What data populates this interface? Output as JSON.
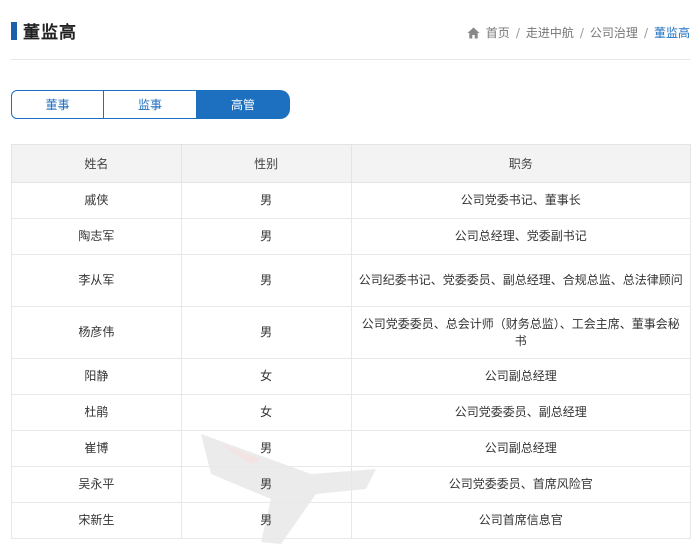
{
  "header": {
    "title": "董监高",
    "breadcrumb": [
      "首页",
      "走进中航",
      "公司治理",
      "董监高"
    ]
  },
  "tabs": [
    {
      "label": "董事",
      "active": false
    },
    {
      "label": "监事",
      "active": false
    },
    {
      "label": "高管",
      "active": true
    }
  ],
  "table": {
    "headers": [
      "姓名",
      "性别",
      "职务"
    ],
    "rows": [
      {
        "name": "戚侠",
        "gender": "男",
        "position": "公司党委书记、董事长"
      },
      {
        "name": "陶志军",
        "gender": "男",
        "position": "公司总经理、党委副书记"
      },
      {
        "name": "李从军",
        "gender": "男",
        "position": "公司纪委书记、党委委员、副总经理、合规总监、总法律顾问"
      },
      {
        "name": "杨彦伟",
        "gender": "男",
        "position": "公司党委委员、总会计师（财务总监）、工会主席、董事会秘书"
      },
      {
        "name": "阳静",
        "gender": "女",
        "position": "公司副总经理"
      },
      {
        "name": "杜鹃",
        "gender": "女",
        "position": "公司党委委员、副总经理"
      },
      {
        "name": "崔博",
        "gender": "男",
        "position": "公司副总经理"
      },
      {
        "name": "吴永平",
        "gender": "男",
        "position": "公司党委委员、首席风险官"
      },
      {
        "name": "宋新生",
        "gender": "男",
        "position": "公司首席信息官"
      }
    ]
  },
  "colors": {
    "accent": "#1d6fc0",
    "title_bar": "#1d5fa8",
    "header_bg": "#f3f3f3"
  },
  "icons": {
    "breadcrumb_home": "home-icon",
    "watermark": "aircraft-watermark"
  }
}
